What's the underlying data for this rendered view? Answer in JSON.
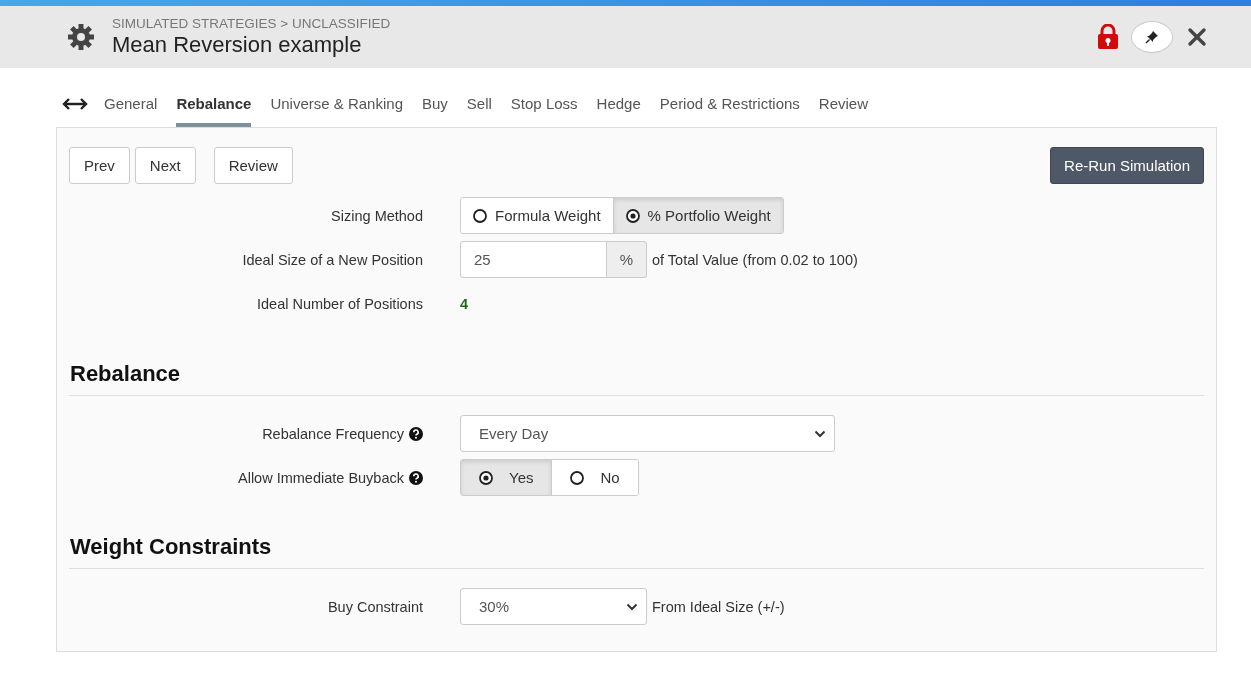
{
  "header": {
    "breadcrumb": "SIMULATED STRATEGIES > UNCLASSIFIED",
    "title": "Mean Reversion example",
    "locked": true
  },
  "tabs": [
    {
      "label": "General",
      "selected": false
    },
    {
      "label": "Rebalance",
      "selected": true
    },
    {
      "label": "Universe & Ranking",
      "selected": false
    },
    {
      "label": "Buy",
      "selected": false
    },
    {
      "label": "Sell",
      "selected": false
    },
    {
      "label": "Stop Loss",
      "selected": false
    },
    {
      "label": "Hedge",
      "selected": false
    },
    {
      "label": "Period & Restrictions",
      "selected": false
    },
    {
      "label": "Review",
      "selected": false
    }
  ],
  "nav_buttons": [
    "Prev",
    "Next",
    "Review"
  ],
  "action_button": "Re-Run Simulation",
  "sections": [
    {
      "fields": [
        {
          "kind": "radio",
          "label": "Sizing Method",
          "help": false,
          "options": [
            {
              "label": "Formula Weight",
              "selected": false
            },
            {
              "label": "% Portfolio Weight",
              "selected": true
            }
          ]
        },
        {
          "kind": "addon",
          "label": "Ideal Size of a New Position",
          "value": "25",
          "addon": "%",
          "suffix": "of Total Value (from 0.02 to 100)"
        },
        {
          "kind": "value",
          "label": "Ideal Number of Positions",
          "value": "4"
        }
      ]
    },
    {
      "heading": "Rebalance",
      "fields": [
        {
          "kind": "select",
          "label": "Rebalance Frequency",
          "help": true,
          "value": "Every Day"
        },
        {
          "kind": "radio",
          "label": "Allow Immediate Buyback",
          "help": true,
          "options": [
            {
              "label": "Yes",
              "selected": true
            },
            {
              "label": "No",
              "selected": false
            }
          ]
        }
      ]
    },
    {
      "heading": "Weight Constraints",
      "fields": [
        {
          "kind": "select",
          "label": "Buy Constraint",
          "help": false,
          "value": "30%",
          "suffix": "From Ideal Size (+/-)"
        }
      ]
    }
  ]
}
